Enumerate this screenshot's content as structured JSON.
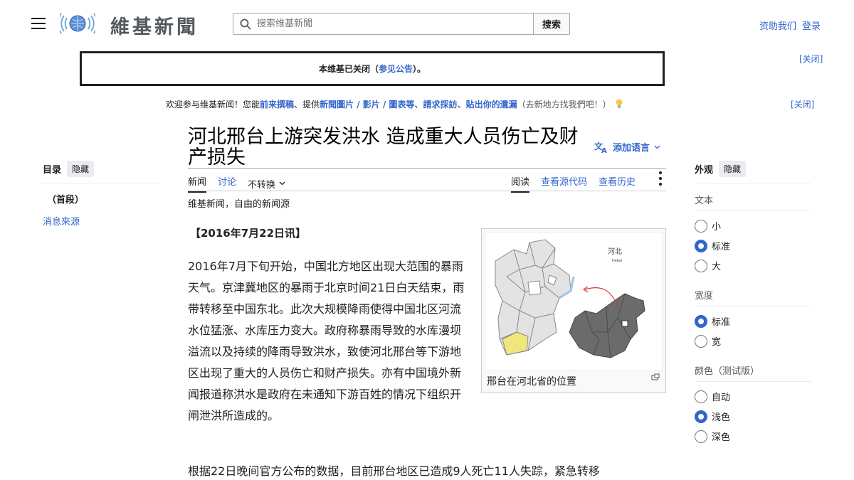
{
  "header": {
    "site_name": "維基新聞",
    "search_placeholder": "搜索维基新聞",
    "search_button": "搜索",
    "donate": "资助我们",
    "login": "登录"
  },
  "site_notice": {
    "text_pre": "本维基已关闭（",
    "link": "参见公告",
    "text_post": "）。",
    "close": "[关闭]"
  },
  "welcome": {
    "t1": "欢迎参与维基新闻！您能",
    "l1": "前来撰稿",
    "t2": "、提供",
    "l2": "新聞圖片 / 影片 / 圖表等",
    "t3": "、",
    "l3": "請求採訪",
    "t4": "、",
    "l4": "貼出你的遺漏",
    "t5": "（去新地方找我們吧！）",
    "close": "[关闭]"
  },
  "article": {
    "title": "河北邢台上游突发洪水 造成重大人员伤亡及财产损失",
    "add_languages": "添加语言",
    "tabs_left": [
      "新闻",
      "讨论",
      "不转换"
    ],
    "tabs_right": [
      "阅读",
      "查看源代码",
      "查看历史"
    ],
    "tagline": "维基新闻，自由的新闻源",
    "dateline": "【2016年7月22日讯】",
    "para1": "2016年7月下旬开始，中国北方地区出现大范围的暴雨天气。京津冀地区的暴雨于北京时间21日白天结束，雨带转移至中国东北。此次大规模降雨使得中国北区河流水位猛涨、水库压力变大。政府称暴雨导致的水库漫坝溢流以及持续的降雨导致洪水，致使河北邢台等下游地区出现了重大的人员伤亡和财产损失。亦有中国境外新闻报道称洪水是政府在未通知下游百姓的情况下组织开闸泄洪所造成的。",
    "para2": "根据22日晚间官方公布的数据，目前邢台地区已造成9人死亡11人失踪，紧急转移",
    "figure_caption": "邢台在河北省的位置",
    "map_label": "河北",
    "map_label_en": "Hebei"
  },
  "toc": {
    "title": "目录",
    "hide": "隐藏",
    "items": [
      "（首段）",
      "消息來源"
    ]
  },
  "appearance": {
    "title": "外观",
    "hide": "隐藏",
    "text_label": "文本",
    "text_options": [
      "小",
      "标准",
      "大"
    ],
    "width_label": "宽度",
    "width_options": [
      "标准",
      "宽"
    ],
    "color_label": "颜色（测试版）",
    "color_options": [
      "自动",
      "浅色",
      "深色"
    ]
  }
}
